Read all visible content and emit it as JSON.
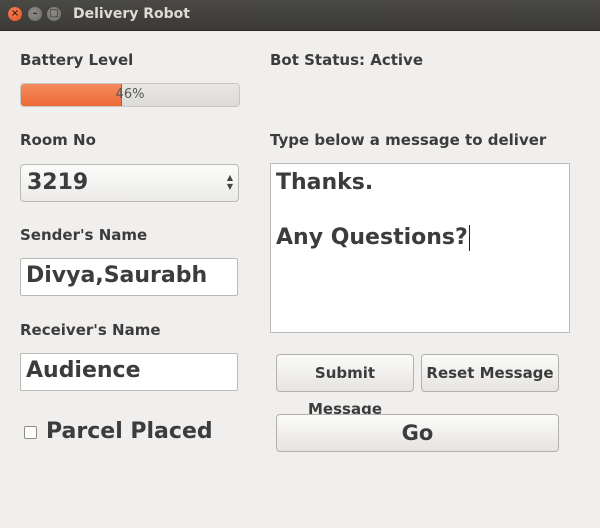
{
  "window": {
    "title": "Delivery Robot"
  },
  "battery": {
    "label": "Battery Level",
    "percent": 46,
    "text": "46%"
  },
  "status": {
    "text": "Bot Status: Active"
  },
  "room": {
    "label": "Room No",
    "value": "3219"
  },
  "message": {
    "label": "Type below a message to deliver",
    "line1": "Thanks.",
    "line2": "Any Questions?"
  },
  "sender": {
    "label": "Sender's Name",
    "value": "Divya,Saurabh"
  },
  "receiver": {
    "label": "Receiver's Name",
    "value": "Audience"
  },
  "buttons": {
    "submit": "Submit Message",
    "reset": "Reset Message",
    "go": "Go"
  },
  "parcel": {
    "label": "Parcel Placed",
    "checked": false
  }
}
